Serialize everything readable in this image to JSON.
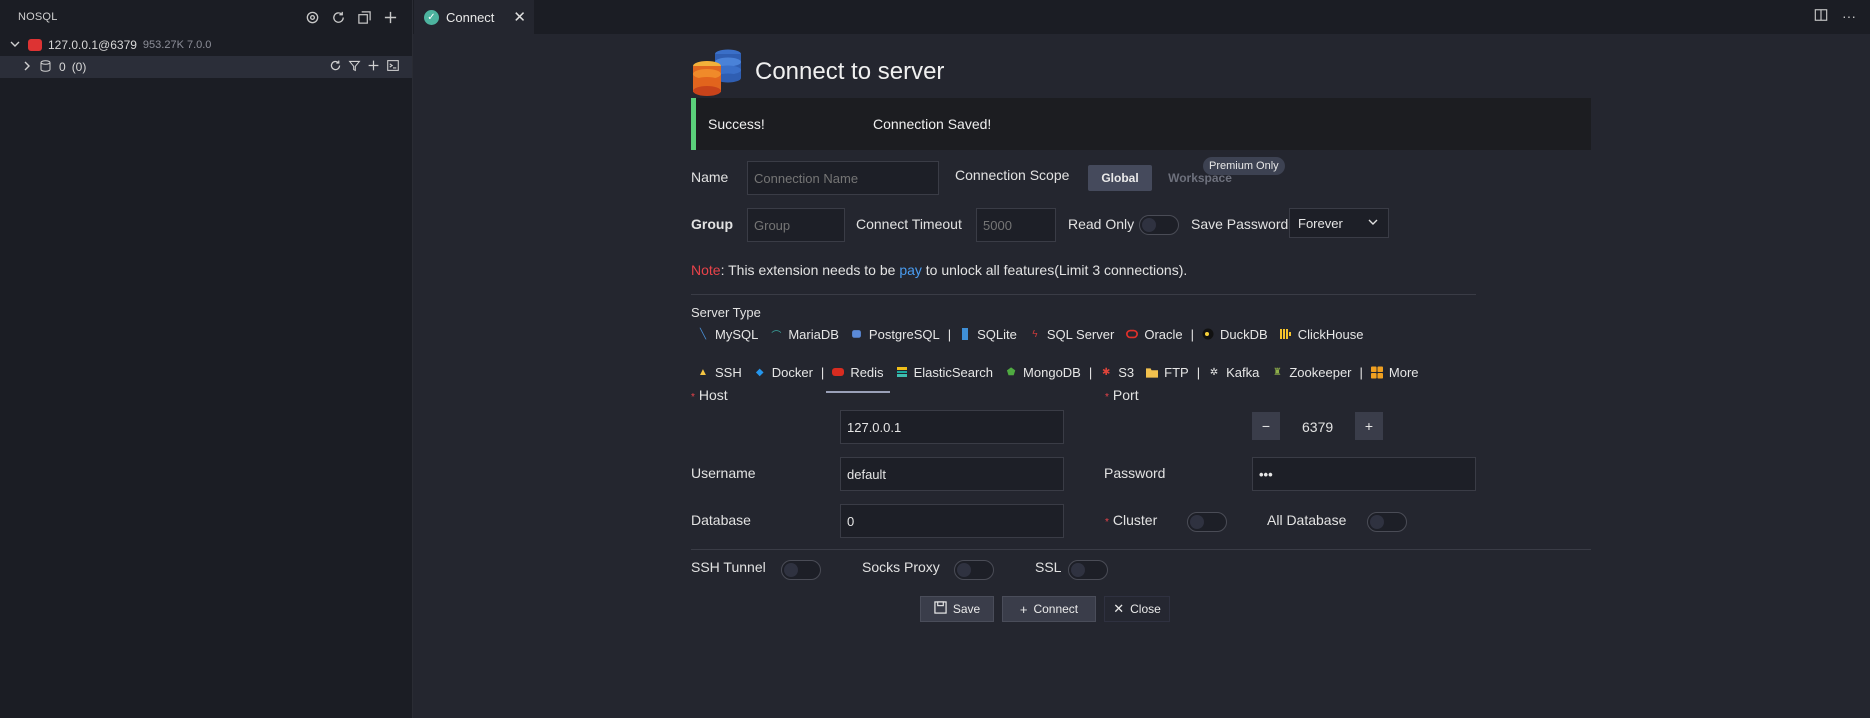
{
  "sidebar": {
    "title": "NOSQL",
    "connection": {
      "name": "127.0.0.1@6379",
      "meta": "953.27K 7.0.0"
    },
    "database": {
      "name": "0",
      "count": "(0)"
    }
  },
  "tabs": [
    {
      "label": "Connect"
    }
  ],
  "form": {
    "title": "Connect to server",
    "alert": {
      "status": "Success!",
      "message": "Connection Saved!"
    },
    "name_label": "Name",
    "name_placeholder": "Connection Name",
    "scope_label": "Connection Scope",
    "scope_global": "Global",
    "scope_workspace": "Workspace",
    "premium_badge": "Premium Only",
    "group_label": "Group",
    "group_placeholder": "Group",
    "timeout_label": "Connect Timeout",
    "timeout_placeholder": "5000",
    "readonly_label": "Read Only",
    "savepw_label": "Save Password",
    "savepw_value": "Forever",
    "note": {
      "prefix": "Note",
      "text1": ": This extension needs to be ",
      "link": "pay",
      "text2": " to unlock all features(Limit 3 connections)."
    },
    "server_type_label": "Server Type",
    "server_types_row1": [
      "MySQL",
      "MariaDB",
      "PostgreSQL",
      "SQLite",
      "SQL Server",
      "Oracle",
      "DuckDB",
      "ClickHouse"
    ],
    "server_types_row2": [
      "SSH",
      "Docker",
      "Redis",
      "ElasticSearch",
      "MongoDB",
      "S3",
      "FTP",
      "Kafka",
      "Zookeeper",
      "More"
    ],
    "selected_server_type": "Redis",
    "host_label": "Host",
    "host_value": "127.0.0.1",
    "port_label": "Port",
    "port_value": "6379",
    "username_label": "Username",
    "username_value": "default",
    "password_label": "Password",
    "password_value": "•••",
    "database_label": "Database",
    "database_value": "0",
    "cluster_label": "Cluster",
    "alldb_label": "All Database",
    "ssh_label": "SSH Tunnel",
    "socks_label": "Socks Proxy",
    "ssl_label": "SSL",
    "save_label": "Save",
    "connect_label": "Connect",
    "close_label": "Close"
  },
  "colors": {
    "accent_success": "#5ad07a",
    "required": "#e8434a",
    "link": "#4a9cf0"
  }
}
